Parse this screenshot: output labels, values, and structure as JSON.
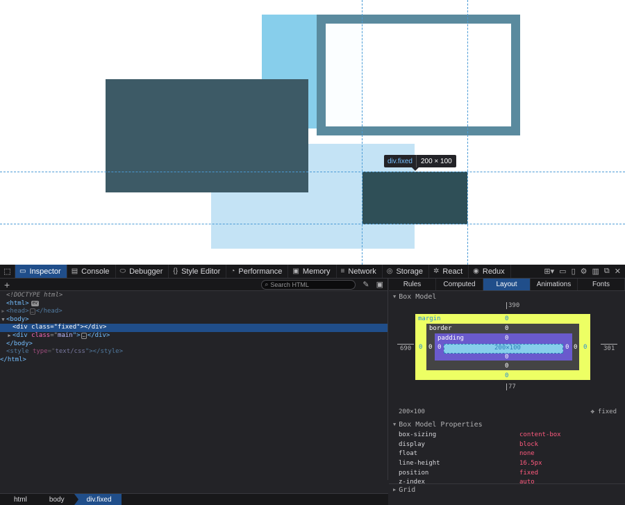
{
  "preview": {
    "tooltip_tag": "div.fixed",
    "tooltip_dims": "200 × 100"
  },
  "colors": {
    "sky_box": "#87ceeb",
    "framed_box_border": "#5a8a9e",
    "dark_box": "#3d5a66",
    "pale_box": "#c4e3f5",
    "fixed_box": "#2f4f57"
  },
  "toolbar": {
    "tabs": [
      {
        "label": "Inspector",
        "icon": "inspector-icon"
      },
      {
        "label": "Console",
        "icon": "console-icon"
      },
      {
        "label": "Debugger",
        "icon": "debugger-icon"
      },
      {
        "label": "Style Editor",
        "icon": "style-editor-icon"
      },
      {
        "label": "Performance",
        "icon": "performance-icon"
      },
      {
        "label": "Memory",
        "icon": "memory-icon"
      },
      {
        "label": "Network",
        "icon": "network-icon"
      },
      {
        "label": "Storage",
        "icon": "storage-icon"
      },
      {
        "label": "React",
        "icon": "react-icon"
      },
      {
        "label": "Redux",
        "icon": "redux-icon"
      }
    ]
  },
  "markup": {
    "search_placeholder": "Search HTML",
    "doctype": "<!DOCTYPE html>",
    "html_tag": "<html>",
    "ev_badge": "ev",
    "head_open": "<head>",
    "head_close": "</head>",
    "body_open": "<body>",
    "sel_open": "<div ",
    "sel_attr": "class",
    "sel_eq": "=\"",
    "sel_val": "fixed",
    "sel_close": "\"></div>",
    "main_open": "<div ",
    "main_attr": "class",
    "main_eq": "=\"",
    "main_val": "main",
    "main_mid": "\">",
    "main_close": "</div>",
    "body_close": "</body>",
    "style_open": "<style ",
    "style_attr": "type",
    "style_eq": "=\"",
    "style_val": "text/css",
    "style_mid": "\">",
    "style_close": "</style>",
    "html_close": "</html>",
    "ellipsis": "…"
  },
  "breadcrumbs": [
    "html",
    "body",
    "div.fixed"
  ],
  "sidebar": {
    "tabs": [
      "Rules",
      "Computed",
      "Layout",
      "Animations",
      "Fonts"
    ],
    "selected_tab": "Layout",
    "box_model_title": "Box Model",
    "box_model": {
      "top": "390",
      "bottom": "77",
      "left": "690",
      "right": "301",
      "margin_label": "margin",
      "border_label": "border",
      "padding_label": "padding",
      "margin": {
        "top": "0",
        "right": "0",
        "bottom": "0",
        "left": "0"
      },
      "border": {
        "top": "0",
        "right": "0",
        "bottom": "0",
        "left": "0"
      },
      "padding": {
        "top": "0",
        "right": "0",
        "bottom": "0",
        "left": "0"
      },
      "content": "200×100"
    },
    "size_summary": "200×100",
    "position_label": "fixed",
    "props_title": "Box Model Properties",
    "properties": [
      {
        "name": "box-sizing",
        "value": "content-box"
      },
      {
        "name": "display",
        "value": "block"
      },
      {
        "name": "float",
        "value": "none"
      },
      {
        "name": "line-height",
        "value": "16.5px"
      },
      {
        "name": "position",
        "value": "fixed"
      },
      {
        "name": "z-index",
        "value": "auto"
      }
    ],
    "grid_title": "Grid"
  }
}
